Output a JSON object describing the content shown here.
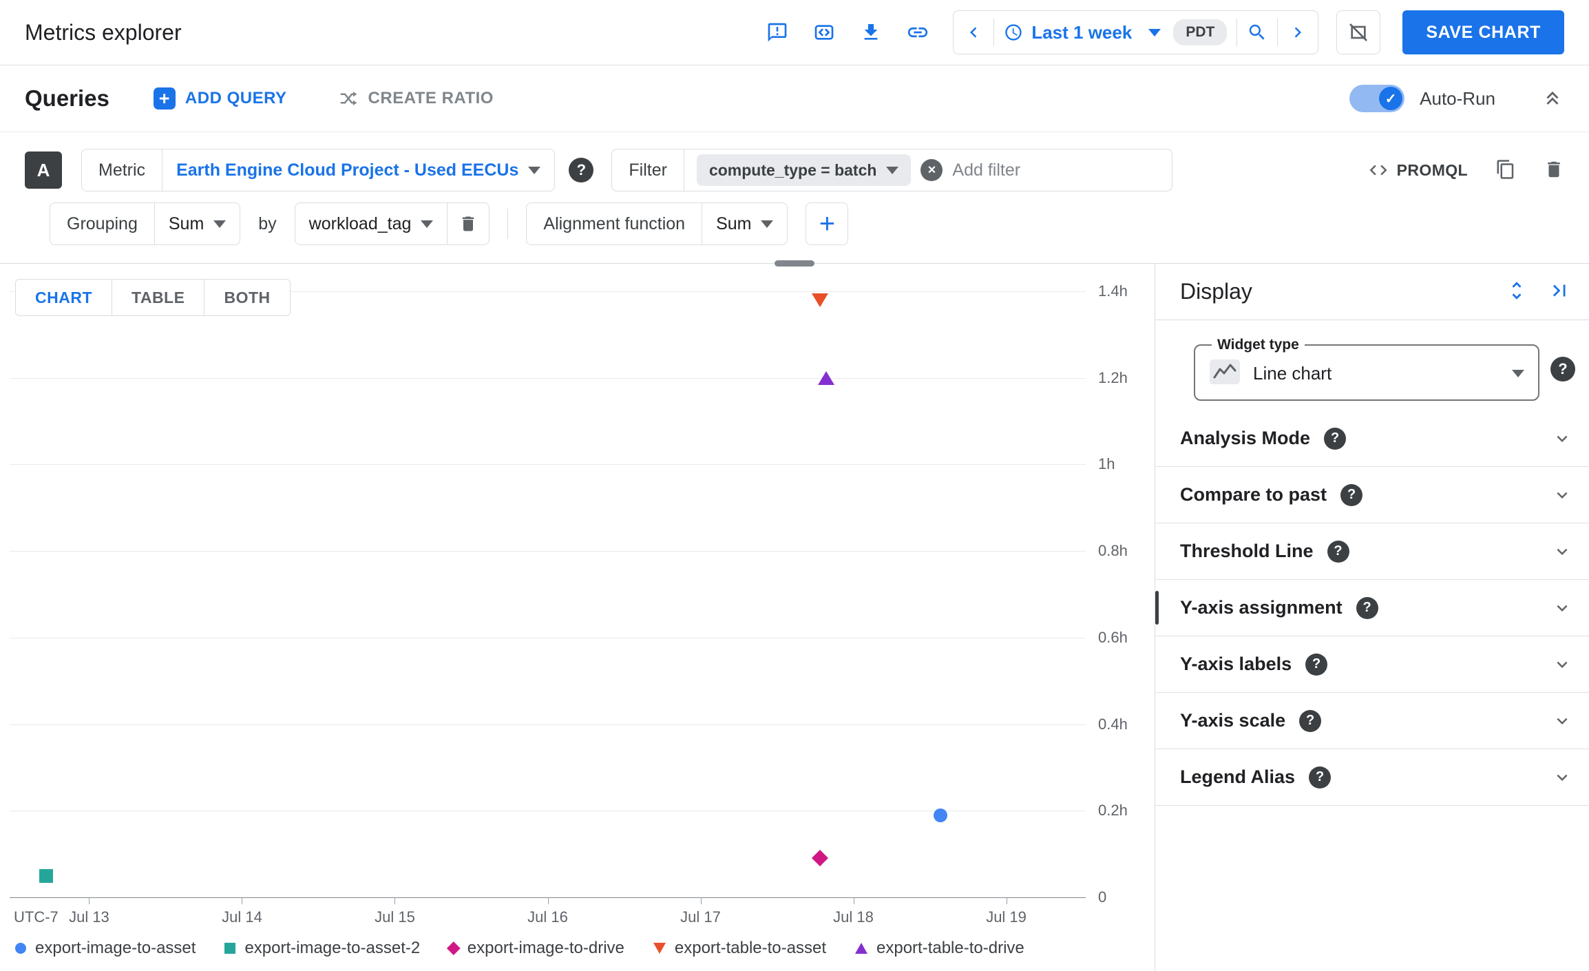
{
  "icons": {
    "help": "?",
    "close": "×",
    "plus": "+",
    "check": "✓"
  },
  "colors": {
    "accent": "#1a73e8"
  },
  "header": {
    "title": "Metrics explorer",
    "time_range": {
      "value": "Last 1 week",
      "timezone": "PDT"
    },
    "save_button": "SAVE CHART"
  },
  "queries": {
    "title": "Queries",
    "add_query_label": "ADD QUERY",
    "create_ratio_label": "CREATE RATIO",
    "auto_run_label": "Auto-Run",
    "auto_run_on": true,
    "query": {
      "letter": "A",
      "metric": {
        "label": "Metric",
        "value": "Earth Engine Cloud Project - Used EECUs"
      },
      "filter": {
        "label": "Filter",
        "chip": "compute_type = batch",
        "placeholder": "Add filter"
      },
      "promql_label": "PROMQL",
      "grouping": {
        "label": "Grouping",
        "value": "Sum"
      },
      "by": {
        "label": "by",
        "value": "workload_tag"
      },
      "alignment": {
        "label": "Alignment function",
        "value": "Sum"
      }
    }
  },
  "chart_view": {
    "tabs": [
      "CHART",
      "TABLE",
      "BOTH"
    ],
    "active_tab": "CHART"
  },
  "chart_data": {
    "type": "scatter",
    "title": "",
    "xlabel": "",
    "ylabel": "",
    "y_unit": "hours",
    "ylim": [
      0,
      1.4
    ],
    "y_ticks": [
      "1.4h",
      "1.2h",
      "1h",
      "0.8h",
      "0.6h",
      "0.4h",
      "0.2h",
      "0"
    ],
    "x_domain_days": [
      12.48,
      19.52
    ],
    "x_ticks": [
      {
        "label": "UTC-7",
        "day": null
      },
      {
        "label": "Jul 13",
        "day": 13
      },
      {
        "label": "Jul 14",
        "day": 14
      },
      {
        "label": "Jul 15",
        "day": 15
      },
      {
        "label": "Jul 16",
        "day": 16
      },
      {
        "label": "Jul 17",
        "day": 17
      },
      {
        "label": "Jul 18",
        "day": 18
      },
      {
        "label": "Jul 19",
        "day": 19
      }
    ],
    "grid": "horizontal",
    "legend_position": "bottom",
    "series": [
      {
        "name": "export-image-to-asset",
        "marker": "circle",
        "color": "#4285f4",
        "points": [
          {
            "day": 18.57,
            "hours": 0.19
          }
        ]
      },
      {
        "name": "export-image-to-asset-2",
        "marker": "square",
        "color": "#26a69a",
        "points": [
          {
            "day": 12.72,
            "hours": 0.05
          }
        ]
      },
      {
        "name": "export-image-to-drive",
        "marker": "diamond",
        "color": "#d01884",
        "points": [
          {
            "day": 17.78,
            "hours": 0.09
          }
        ]
      },
      {
        "name": "export-table-to-asset",
        "marker": "triangle-down",
        "color": "#e8502a",
        "points": [
          {
            "day": 17.78,
            "hours": 1.38
          }
        ]
      },
      {
        "name": "export-table-to-drive",
        "marker": "triangle-up",
        "color": "#8430ce",
        "points": [
          {
            "day": 17.82,
            "hours": 1.2
          }
        ]
      }
    ]
  },
  "display_panel": {
    "title": "Display",
    "widget_type": {
      "label": "Widget type",
      "value": "Line chart"
    },
    "sections": [
      {
        "label": "Analysis Mode"
      },
      {
        "label": "Compare to past"
      },
      {
        "label": "Threshold Line"
      },
      {
        "label": "Y-axis assignment",
        "indicator": true
      },
      {
        "label": "Y-axis labels"
      },
      {
        "label": "Y-axis scale"
      },
      {
        "label": "Legend Alias"
      }
    ]
  }
}
